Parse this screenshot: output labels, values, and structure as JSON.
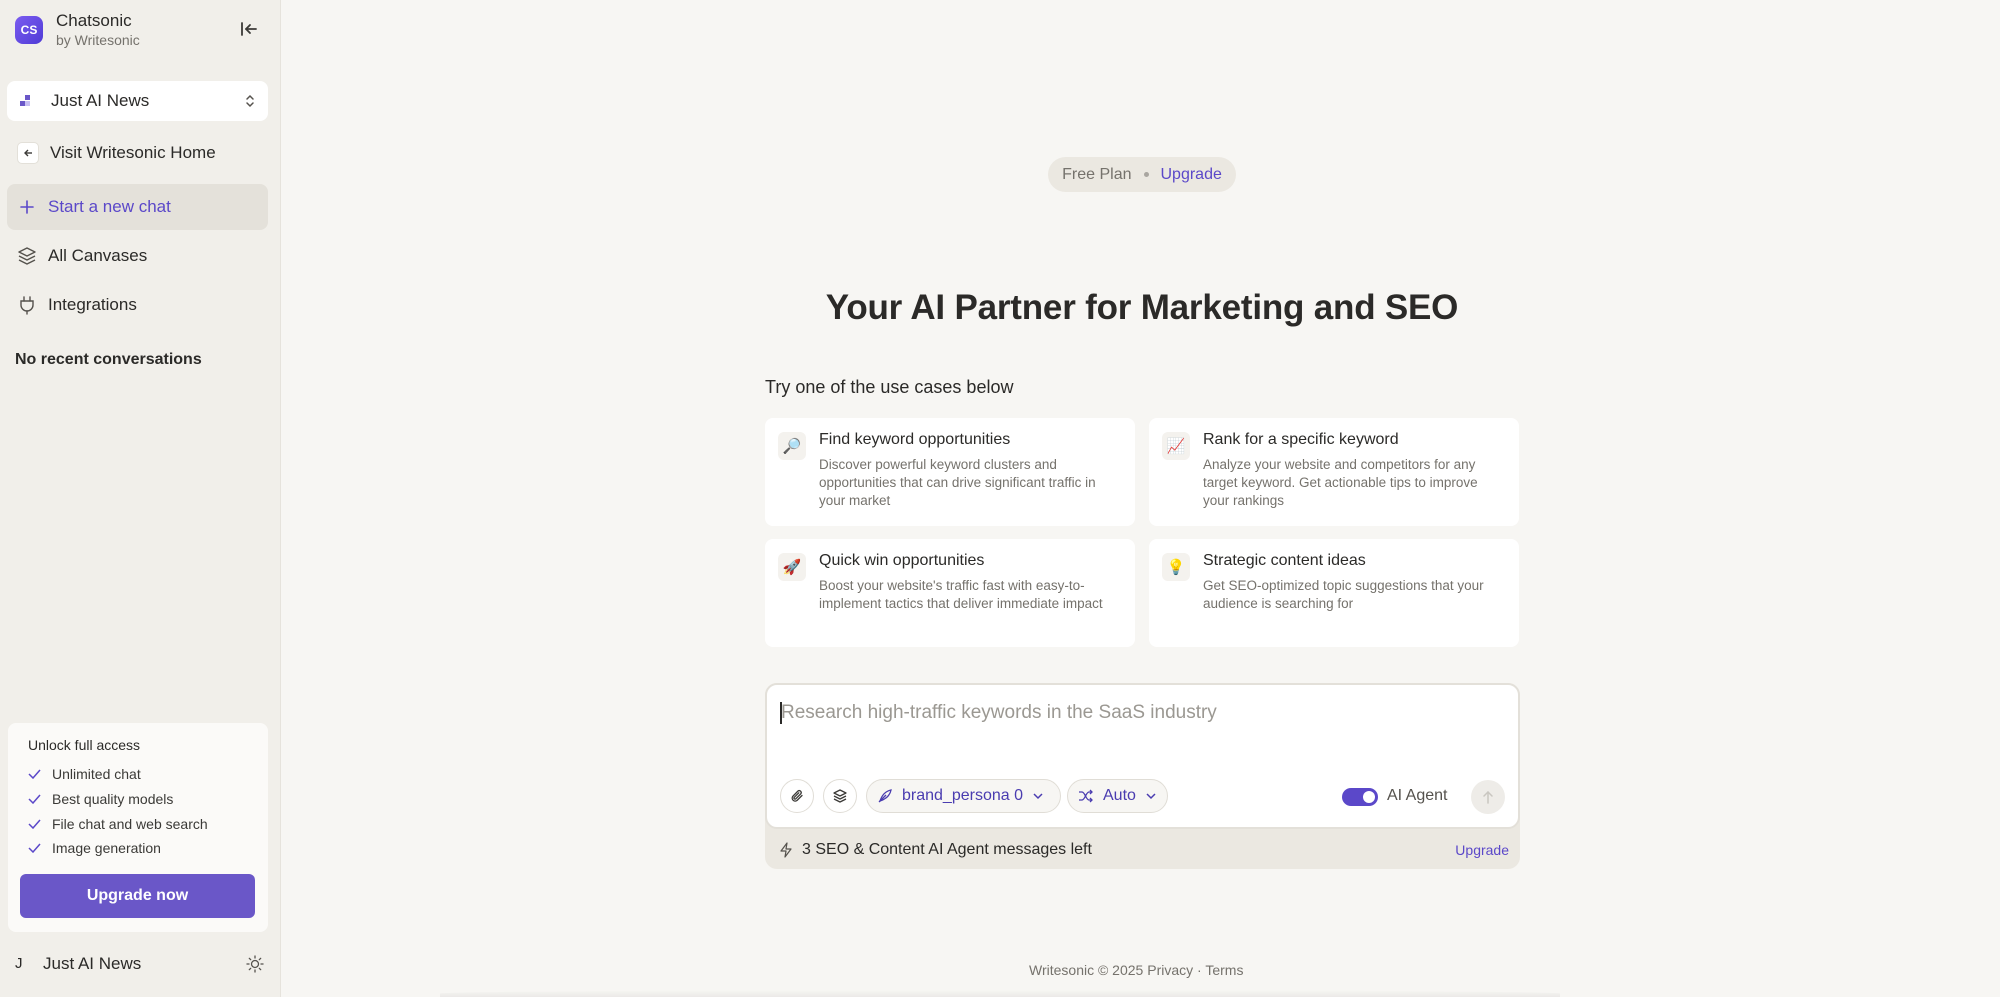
{
  "sidebar": {
    "brand": {
      "logo_text": "CS",
      "name": "Chatsonic",
      "sub": "by Writesonic"
    },
    "workspace": "Just AI News",
    "nav": {
      "visit": "Visit Writesonic Home",
      "new_chat": "Start a new chat",
      "canvases": "All Canvases",
      "integrations": "Integrations"
    },
    "recent_heading": "No recent conversations",
    "unlock": {
      "title": "Unlock full access",
      "features": [
        "Unlimited chat",
        "Best quality models",
        "File chat and web search",
        "Image generation"
      ],
      "cta": "Upgrade now"
    },
    "user": {
      "initial": "J",
      "name": "Just AI News"
    }
  },
  "main": {
    "plan": {
      "label": "Free Plan",
      "upgrade": "Upgrade"
    },
    "title": "Your AI Partner for Marketing and SEO",
    "usecase_label": "Try one of the use cases below",
    "cards": [
      {
        "emoji": "🔎",
        "title": "Find keyword opportunities",
        "desc": "Discover powerful keyword clusters and opportunities that can drive significant traffic in your market"
      },
      {
        "emoji": "📈",
        "title": "Rank for a specific keyword",
        "desc": "Analyze your website and competitors for any target keyword. Get actionable tips to improve your rankings"
      },
      {
        "emoji": "🚀",
        "title": "Quick win opportunities",
        "desc": "Boost your website's traffic fast with easy-to-implement tactics that deliver immediate impact"
      },
      {
        "emoji": "💡",
        "title": "Strategic content ideas",
        "desc": "Get SEO-optimized topic suggestions that your audience is searching for"
      }
    ],
    "composer": {
      "placeholder": "Research high-traffic keywords in the SaaS industry",
      "persona": "brand_persona 0",
      "mode": "Auto",
      "agent_label": "AI Agent",
      "agent_on": true
    },
    "quota": {
      "text": "3 SEO & Content AI Agent messages left",
      "upgrade": "Upgrade"
    },
    "footer": {
      "copyright": "Writesonic © 2025",
      "privacy": "Privacy",
      "sep": "·",
      "terms": "Terms"
    }
  },
  "colors": {
    "accent": "#5b48c9",
    "button": "#6a57c8",
    "sidebar_bg": "#f1efea",
    "page_bg": "#f7f6f3"
  }
}
